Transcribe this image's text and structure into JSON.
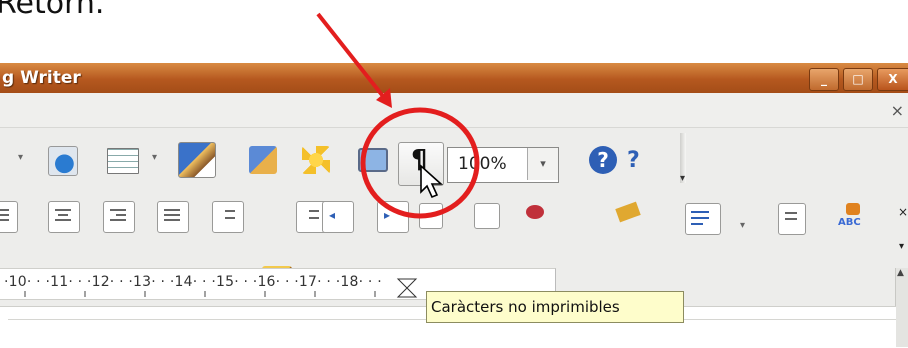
{
  "caption": {
    "text": "Retorn."
  },
  "window": {
    "title": "g Writer",
    "buttons": {
      "minimize": "_",
      "maximize": "□",
      "close": "X"
    },
    "menubar_close": "×"
  },
  "toolbar": {
    "zoom_value": "100%",
    "pilcrow": "¶",
    "help": "?",
    "whats_this": "?"
  },
  "tooltip": {
    "text": "Caràcters no imprimibles"
  },
  "ruler": {
    "text": "·10· · ·11· · ·12· · ·13· · ·14· · ·15· · ·16· · ·17· · ·18· · ·"
  },
  "annotation": {
    "color": "#e31e1e"
  }
}
